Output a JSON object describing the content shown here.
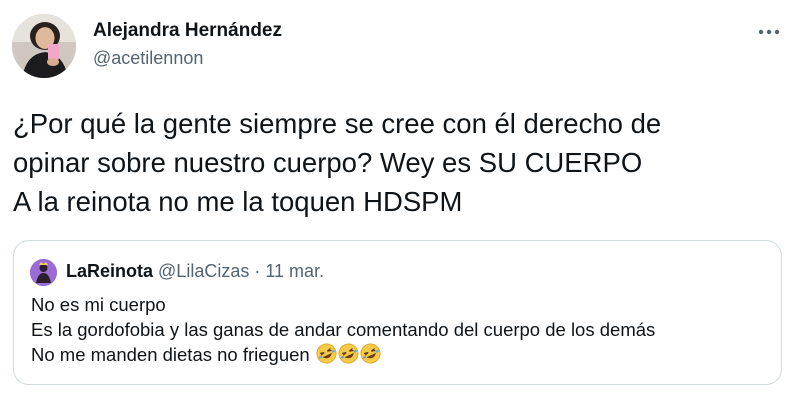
{
  "author": {
    "name": "Alejandra Hernández",
    "handle": "@acetilennon"
  },
  "more_icon": "more-horizontal-icon",
  "tweet": {
    "lines": [
      "¿Por qué la gente siempre se cree con él derecho de",
      "opinar sobre nuestro cuerpo? Wey es SU CUERPO",
      "A la reinota no me la toquen HDSPM"
    ]
  },
  "quoted": {
    "name": "LaReinota",
    "handle": "@LilaCizas",
    "separator": "·",
    "date": "11 mar.",
    "lines": [
      "No es mi cuerpo",
      "Es la gordofobia y las ganas de andar comentando del cuerpo de los demás",
      "No me manden dietas no frieguen"
    ],
    "emoji": [
      "🤣",
      "🤣",
      "🤣"
    ]
  },
  "colors": {
    "text": "#0f1419",
    "secondary": "#536471",
    "border": "#cfd9de",
    "quoted_avatar": "#9b6bd6",
    "emoji_yellow": "#f7c948"
  }
}
